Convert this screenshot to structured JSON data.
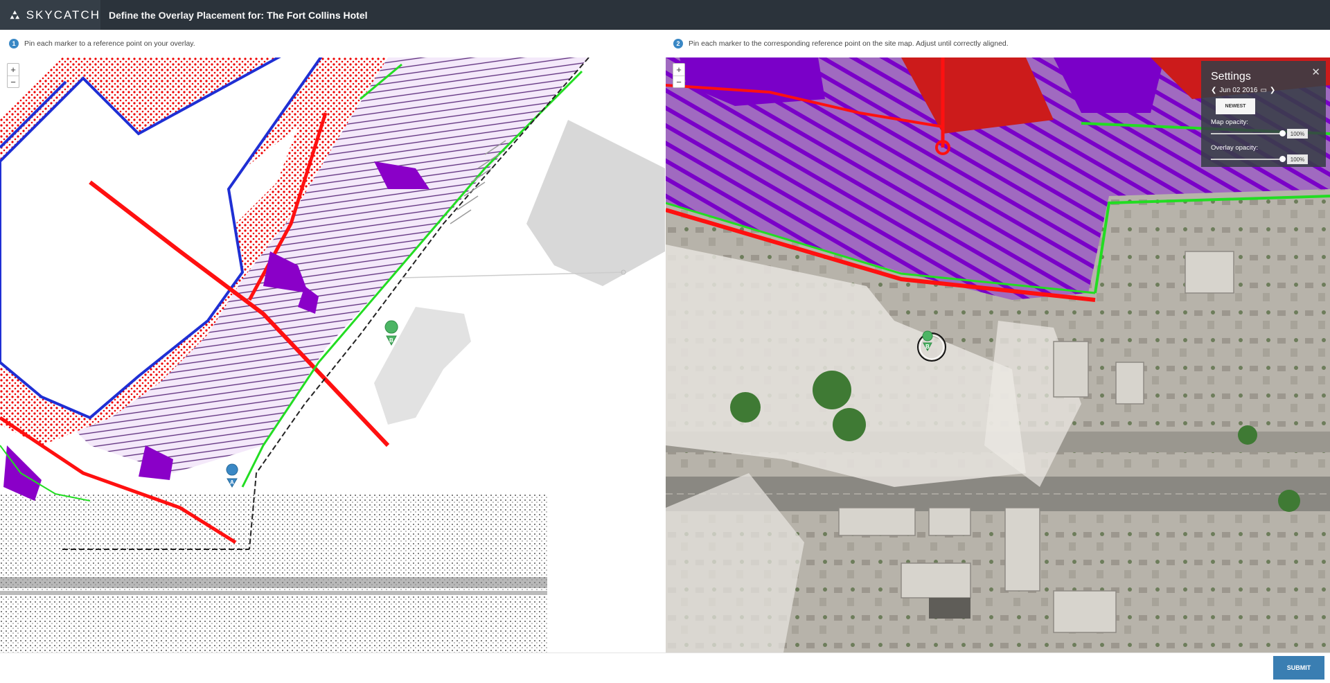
{
  "header": {
    "brand": "SKYCATCH",
    "title_prefix": "Define the Overlay Placement for:",
    "site_name": "The Fort Collins Hotel"
  },
  "steps": [
    {
      "num": "1",
      "text": "Pin each marker to a reference point on your overlay."
    },
    {
      "num": "2",
      "text": "Pin each marker to the corresponding reference point on the site map. Adjust until correctly aligned."
    }
  ],
  "zoom": {
    "in": "+",
    "out": "−"
  },
  "markers": {
    "a": "A",
    "b": "B"
  },
  "settings": {
    "title": "Settings",
    "date": "Jun 02 2016",
    "newest": "NEWEST",
    "map_opacity_label": "Map opacity:",
    "map_opacity_value": "100%",
    "map_opacity": 1.0,
    "overlay_opacity_label": "Overlay opacity:",
    "overlay_opacity_value": "100%",
    "overlay_opacity": 1.0
  },
  "footer": {
    "submit": "SUBMIT"
  },
  "colors": {
    "header_bg": "#2b333b",
    "accent": "#3a7eb2",
    "overlay_red": "#ff1010",
    "overlay_purple": "#8a00c8",
    "overlay_green": "#22dd22",
    "overlay_blue": "#1f2fd4"
  },
  "icons": [
    "skycatch-logo-icon",
    "calendar-icon",
    "chevron-left-icon",
    "chevron-right-icon",
    "close-icon",
    "map-pin-icon"
  ]
}
